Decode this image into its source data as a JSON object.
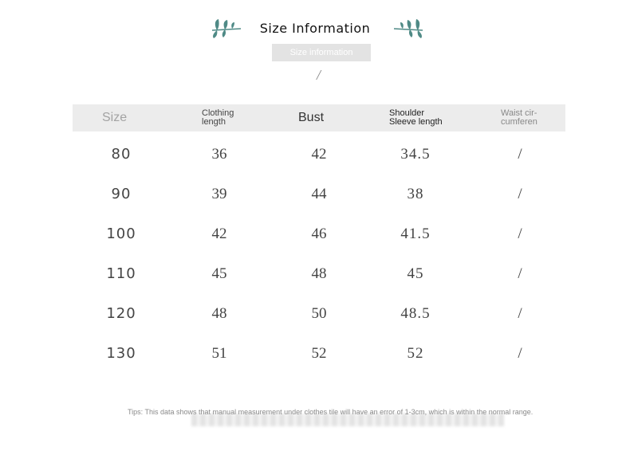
{
  "page": {
    "title": "Size Information",
    "subtitle": "Size information",
    "subtitle_mark": "/"
  },
  "table": {
    "headers": {
      "size": "Size",
      "clothing_length": "Clothing\nlength",
      "bust": "Bust",
      "shoulder_sleeve": "Shoulder\nSleeve length",
      "waist": "Waist cir-\ncumferen"
    },
    "rows": [
      {
        "size": "80",
        "clothing_length": "36",
        "bust": "42",
        "shoulder_sleeve": "34.5",
        "waist": "/"
      },
      {
        "size": "90",
        "clothing_length": "39",
        "bust": "44",
        "shoulder_sleeve": "38",
        "waist": "/"
      },
      {
        "size": "100",
        "clothing_length": "42",
        "bust": "46",
        "shoulder_sleeve": "41.5",
        "waist": "/"
      },
      {
        "size": "110",
        "clothing_length": "45",
        "bust": "48",
        "shoulder_sleeve": "45",
        "waist": "/"
      },
      {
        "size": "120",
        "clothing_length": "48",
        "bust": "50",
        "shoulder_sleeve": "48.5",
        "waist": "/"
      },
      {
        "size": "130",
        "clothing_length": "51",
        "bust": "52",
        "shoulder_sleeve": "52",
        "waist": "/"
      }
    ]
  },
  "tips": "Tips: This data shows that manual measurement under clothes tile will have an error of 1-3cm, which is within the normal range.",
  "colors": {
    "leaf": "#4f8a86",
    "header_background": "#ececec",
    "subtitle_box": "#e3e3e3"
  },
  "icons": {
    "left_decoration": "leaf-branch-icon",
    "right_decoration": "leaf-branch-icon"
  }
}
